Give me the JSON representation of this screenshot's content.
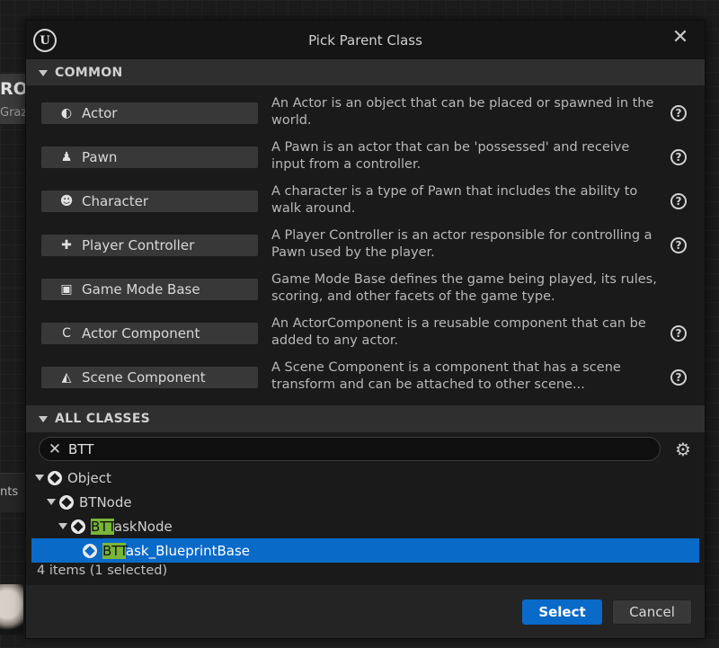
{
  "background": {
    "left_heading": "RO",
    "left_sub": "Graz",
    "left_label": "nts"
  },
  "dialog": {
    "title": "Pick Parent Class",
    "close_glyph": "✕",
    "logo_glyph": "U"
  },
  "common": {
    "header": "COMMON",
    "items": [
      {
        "label": "Actor",
        "icon": "actor-icon",
        "glyph": "◐",
        "description": "An Actor is an object that can be placed or spawned in the world.",
        "help": true
      },
      {
        "label": "Pawn",
        "icon": "pawn-icon",
        "glyph": "♟",
        "description": "A Pawn is an actor that can be 'possessed' and receive input from a controller.",
        "help": true
      },
      {
        "label": "Character",
        "icon": "character-icon",
        "glyph": "☻",
        "description": "A character is a type of Pawn that includes the ability to walk around.",
        "help": true
      },
      {
        "label": "Player Controller",
        "icon": "gamepad-icon",
        "glyph": "✚",
        "description": "A Player Controller is an actor responsible for controlling a Pawn used by the player.",
        "help": true
      },
      {
        "label": "Game Mode Base",
        "icon": "game-mode-icon",
        "glyph": "▣",
        "description": "Game Mode Base defines the game being played, its rules, scoring, and other facets of the game type.",
        "help": false
      },
      {
        "label": "Actor Component",
        "icon": "actor-component-icon",
        "glyph": "C",
        "description": "An ActorComponent is a reusable component that can be added to any actor.",
        "help": true
      },
      {
        "label": "Scene Component",
        "icon": "scene-component-icon",
        "glyph": "◭",
        "description": "A Scene Component is a component that has a scene transform and can be attached to other scene...",
        "help": true
      }
    ],
    "help_glyph": "?"
  },
  "all_classes": {
    "header": "ALL CLASSES",
    "search_value": "BTT",
    "clear_glyph": "✕",
    "gear_glyph": "⚙",
    "tree": [
      {
        "level": 0,
        "expanded": true,
        "highlight": "",
        "rest": "Object",
        "selected": false
      },
      {
        "level": 1,
        "expanded": true,
        "highlight": "",
        "rest": "BTNode",
        "selected": false
      },
      {
        "level": 2,
        "expanded": true,
        "highlight": "BTT",
        "rest": "askNode",
        "selected": false
      },
      {
        "level": 3,
        "expanded": false,
        "highlight": "BTT",
        "rest": "ask_BlueprintBase",
        "selected": true
      }
    ],
    "status": "4 items (1 selected)"
  },
  "footer": {
    "select_label": "Select",
    "cancel_label": "Cancel"
  },
  "colors": {
    "accent": "#0a6ac8",
    "highlight": "#7ab53a"
  }
}
